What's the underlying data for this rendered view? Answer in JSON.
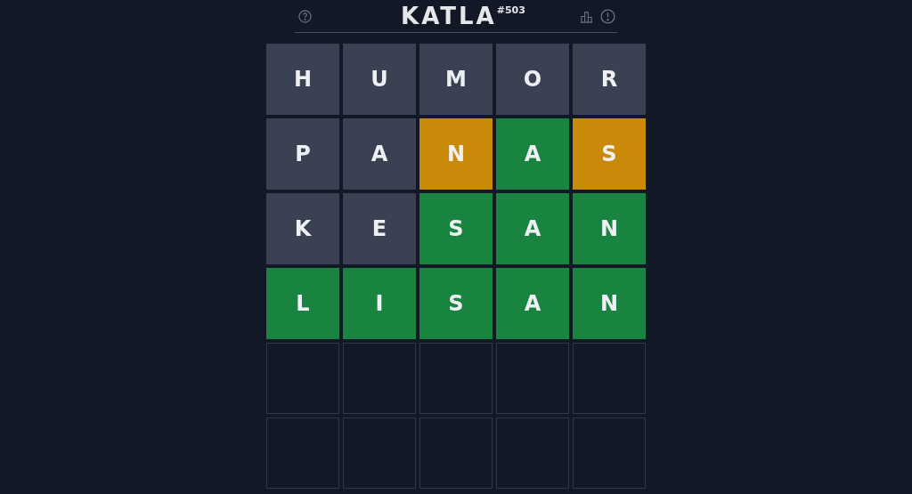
{
  "header": {
    "title": "KATLA",
    "edition": "#503"
  },
  "board": [
    {
      "tiles": [
        {
          "letter": "H",
          "kind": "absent"
        },
        {
          "letter": "U",
          "kind": "absent"
        },
        {
          "letter": "M",
          "kind": "absent"
        },
        {
          "letter": "O",
          "kind": "absent"
        },
        {
          "letter": "R",
          "kind": "absent"
        }
      ]
    },
    {
      "tiles": [
        {
          "letter": "P",
          "kind": "absent"
        },
        {
          "letter": "A",
          "kind": "absent"
        },
        {
          "letter": "N",
          "kind": "present"
        },
        {
          "letter": "A",
          "kind": "correct"
        },
        {
          "letter": "S",
          "kind": "present"
        }
      ]
    },
    {
      "tiles": [
        {
          "letter": "K",
          "kind": "absent"
        },
        {
          "letter": "E",
          "kind": "absent"
        },
        {
          "letter": "S",
          "kind": "correct"
        },
        {
          "letter": "A",
          "kind": "correct"
        },
        {
          "letter": "N",
          "kind": "correct"
        }
      ]
    },
    {
      "tiles": [
        {
          "letter": "L",
          "kind": "correct"
        },
        {
          "letter": "I",
          "kind": "correct"
        },
        {
          "letter": "S",
          "kind": "correct"
        },
        {
          "letter": "A",
          "kind": "correct"
        },
        {
          "letter": "N",
          "kind": "correct"
        }
      ]
    },
    {
      "tiles": [
        {
          "kind": "empty"
        },
        {
          "kind": "empty"
        },
        {
          "kind": "empty"
        },
        {
          "kind": "empty"
        },
        {
          "kind": "empty"
        }
      ]
    },
    {
      "tiles": [
        {
          "kind": "empty"
        },
        {
          "kind": "empty"
        },
        {
          "kind": "empty"
        },
        {
          "kind": "empty"
        },
        {
          "kind": "empty"
        }
      ]
    }
  ]
}
